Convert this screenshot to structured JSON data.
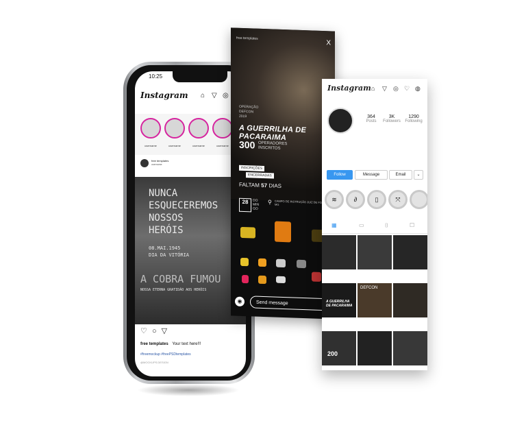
{
  "phone": {
    "time": "10:25",
    "app_name": "Instagram",
    "stories": [
      {
        "label": "username"
      },
      {
        "label": "username"
      },
      {
        "label": "username"
      },
      {
        "label": "username"
      }
    ],
    "post": {
      "account": "free templates",
      "account_sub": "username",
      "lines": [
        "NUNCA",
        "ESQUECEREMOS",
        "NOSSOS",
        "HERÓIS"
      ],
      "date_line": "08.MAI.1945",
      "day_line": "DIA DA VITÓRIA",
      "big_text": "A COBRA FUMOU",
      "gratitude": "NOSSA ETERNA GRATIDÃO AOS HERÓIS",
      "caption_user": "free templates",
      "caption_text": "Your text here!!!",
      "hashtags": "#freemockup #freePSDtemplates",
      "credit": "@MOCKUPS.DESIGN"
    }
  },
  "story": {
    "account": "free templates",
    "close": "X",
    "operation_lines": [
      "OPERAÇÃO",
      "DEFCON",
      "2019"
    ],
    "title": "A GUERRILHA DE PACARAIMA",
    "count": "300",
    "count_line1": "OPERADORES",
    "count_line2": "INSCRITOS",
    "closed1": "INSCRIÇÕES",
    "closed2": "ENCERRADAS",
    "faltam_label": "FALTAM",
    "faltam_value": "57",
    "faltam_unit": "DIAS",
    "date_num": "28",
    "date_month": "DO MIN GO",
    "location": "CAMPO DE INSTRUÇÃO JUIZ DE FORA - MG",
    "send_placeholder": "Send message"
  },
  "profile": {
    "app_name": "Instagram",
    "stats": [
      {
        "value": "364",
        "label": "Posts"
      },
      {
        "value": "3K",
        "label": "Followers"
      },
      {
        "value": "1290",
        "label": "Following"
      }
    ],
    "follow": "Follow",
    "message": "Message",
    "email": "Email",
    "post_texts": [
      "A GUERRILHA DE PACARAIMA",
      "DEFCON",
      "200"
    ]
  }
}
